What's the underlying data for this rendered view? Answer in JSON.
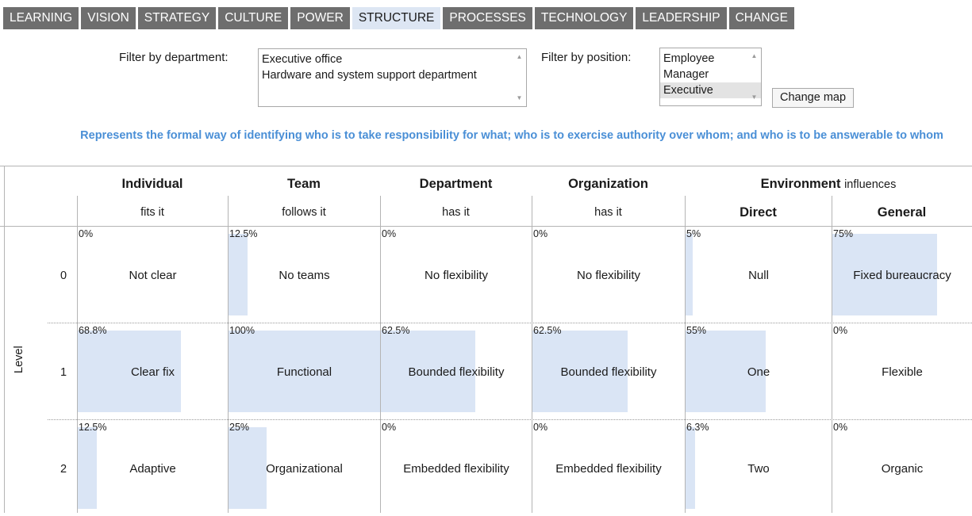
{
  "tabs": [
    {
      "label": "LEARNING"
    },
    {
      "label": "VISION"
    },
    {
      "label": "STRATEGY"
    },
    {
      "label": "CULTURE"
    },
    {
      "label": "POWER"
    },
    {
      "label": "STRUCTURE",
      "active": true
    },
    {
      "label": "PROCESSES"
    },
    {
      "label": "TECHNOLOGY"
    },
    {
      "label": "LEADERSHIP"
    },
    {
      "label": "CHANGE"
    }
  ],
  "filters": {
    "department_label": "Filter by department:",
    "department_options": [
      "Executive office",
      "Hardware and system support department"
    ],
    "position_label": "Filter by position:",
    "position_options": [
      "Employee",
      "Manager",
      "Executive"
    ],
    "position_selected": "Executive",
    "change_map_label": "Change map"
  },
  "description": "Represents the formal way of identifying who is to take responsibility for what; who is to exercise authority over whom; and who is to be answerable to whom",
  "columns": {
    "individual": {
      "title": "Individual",
      "sub": "fits it"
    },
    "team": {
      "title": "Team",
      "sub": "follows it"
    },
    "department": {
      "title": "Department",
      "sub": "has it"
    },
    "organization": {
      "title": "Organization",
      "sub": "has it"
    },
    "environment": {
      "title": "Environment",
      "title_suffix": "influences"
    },
    "direct": {
      "sub": "Direct"
    },
    "general": {
      "sub": "General"
    }
  },
  "level_label": "Level",
  "levels": [
    "0",
    "1",
    "2"
  ],
  "cells": [
    [
      {
        "pct": "0%",
        "value": 0,
        "label": "Not clear"
      },
      {
        "pct": "12.5%",
        "value": 12.5,
        "label": "No teams"
      },
      {
        "pct": "0%",
        "value": 0,
        "label": "No flexibility"
      },
      {
        "pct": "0%",
        "value": 0,
        "label": "No flexibility"
      },
      {
        "pct": "5%",
        "value": 5,
        "label": "Null"
      },
      {
        "pct": "75%",
        "value": 75,
        "label": "Fixed bureaucracy"
      }
    ],
    [
      {
        "pct": "68.8%",
        "value": 68.8,
        "label": "Clear fix"
      },
      {
        "pct": "100%",
        "value": 100,
        "label": "Functional"
      },
      {
        "pct": "62.5%",
        "value": 62.5,
        "label": "Bounded flexibility"
      },
      {
        "pct": "62.5%",
        "value": 62.5,
        "label": "Bounded flexibility"
      },
      {
        "pct": "55%",
        "value": 55,
        "label": "One"
      },
      {
        "pct": "0%",
        "value": 0,
        "label": "Flexible"
      }
    ],
    [
      {
        "pct": "12.5%",
        "value": 12.5,
        "label": "Adaptive"
      },
      {
        "pct": "25%",
        "value": 25,
        "label": "Organizational"
      },
      {
        "pct": "0%",
        "value": 0,
        "label": "Embedded flexibility"
      },
      {
        "pct": "0%",
        "value": 0,
        "label": "Embedded flexibility"
      },
      {
        "pct": "6.3%",
        "value": 6.3,
        "label": "Two"
      },
      {
        "pct": "0%",
        "value": 0,
        "label": "Organic"
      }
    ]
  ],
  "colors": {
    "bar": "#dae5f5",
    "tab_bg": "#6e6e6e",
    "tab_active_bg": "#dde6f3",
    "description": "#4a8fd6"
  }
}
